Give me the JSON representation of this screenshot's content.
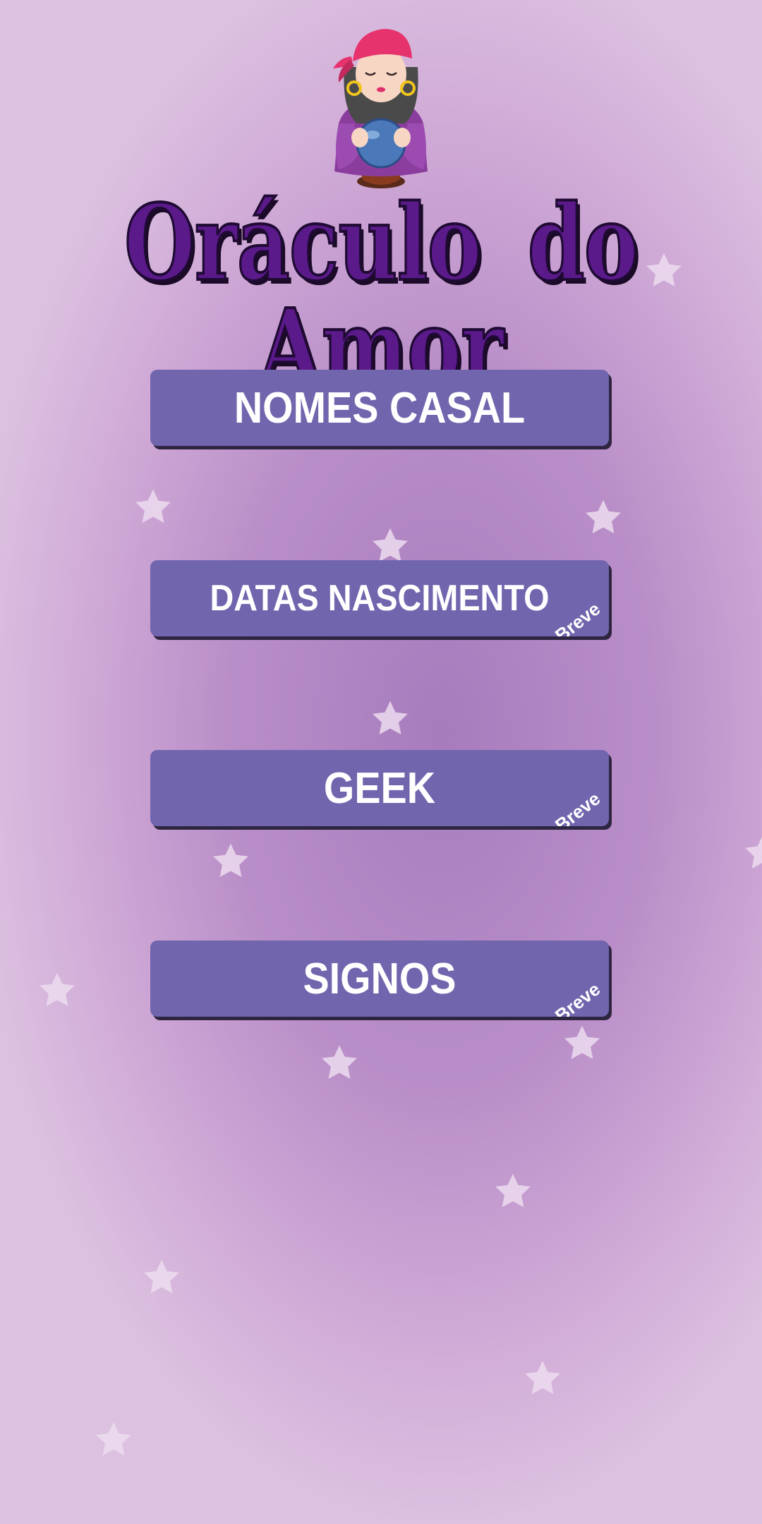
{
  "app": {
    "title": "Oráculo do Amor",
    "logo_icon": "fortune-teller-icon"
  },
  "menu": {
    "items": [
      {
        "id": "nomes-casal",
        "label": "NOMES CASAL",
        "badge": ""
      },
      {
        "id": "datas-nascimento",
        "label": "DATAS NASCIMENTO",
        "badge": "Em Breve"
      },
      {
        "id": "geek",
        "label": "GEEK",
        "badge": "Em Breve"
      },
      {
        "id": "signos",
        "label": "SIGNOS",
        "badge": "Em Breve"
      }
    ]
  },
  "decor": {
    "star_icon": "star-icon"
  },
  "colors": {
    "button": "#7165ae",
    "button_shadow": "#2e2541",
    "title": "#5a1a8a",
    "star": "#ecdcee"
  }
}
